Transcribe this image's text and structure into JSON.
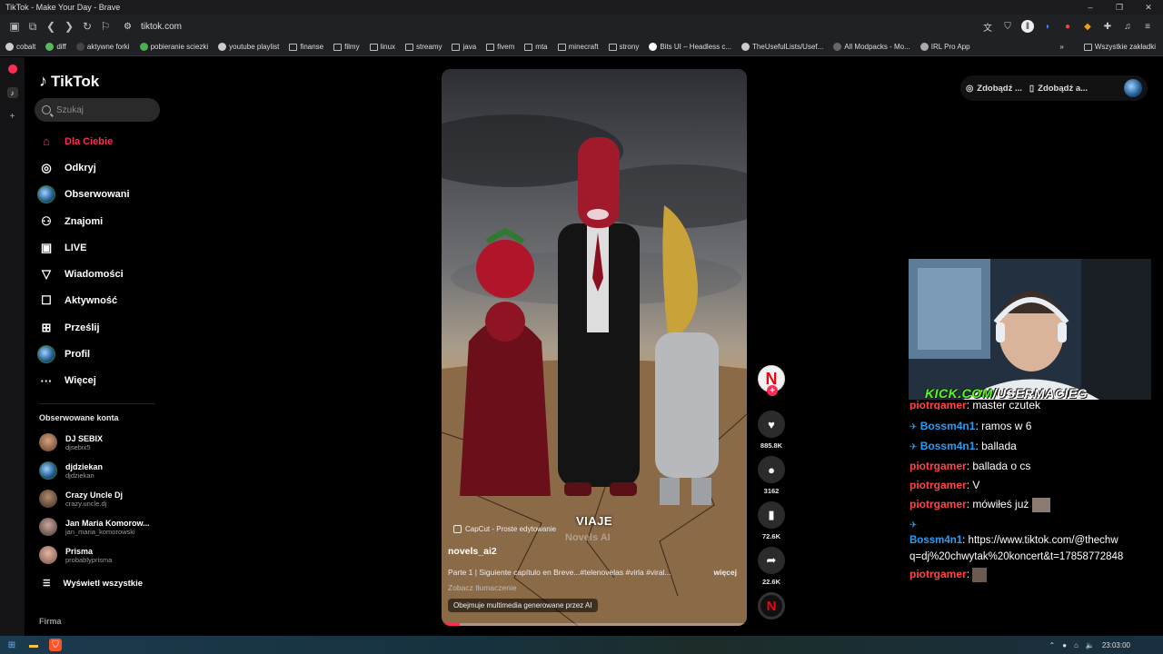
{
  "window": {
    "title": "TikTok - Make Your Day - Brave"
  },
  "address": {
    "url": "tiktok.com"
  },
  "bookmarks": {
    "items": [
      "cobalt",
      "diff",
      "aktywne forki",
      "pobieranie sciezki",
      "youtube playlist",
      "finanse",
      "filmy",
      "linux",
      "streamy",
      "java",
      "fivem",
      "mta",
      "minecraft",
      "strony",
      "Bits UI – Headless c...",
      "TheUsefulLists/Usef...",
      "All Modpacks - Mo...",
      "IRL Pro App"
    ],
    "more": "»",
    "all": "Wszystkie zakładki"
  },
  "sidebar": {
    "logo": "TikTok",
    "search_placeholder": "Szukaj",
    "menu": [
      {
        "label": "Dla Ciebie",
        "icon": "home-icon"
      },
      {
        "label": "Odkryj",
        "icon": "compass-icon"
      },
      {
        "label": "Obserwowani",
        "icon": "avatar"
      },
      {
        "label": "Znajomi",
        "icon": "friends-icon"
      },
      {
        "label": "LIVE",
        "icon": "live-icon"
      },
      {
        "label": "Wiadomości",
        "icon": "send-icon"
      },
      {
        "label": "Aktywność",
        "icon": "activity-icon"
      },
      {
        "label": "Prześlij",
        "icon": "upload-icon"
      },
      {
        "label": "Profil",
        "icon": "profile-icon"
      },
      {
        "label": "Więcej",
        "icon": "more-icon"
      }
    ],
    "following_header": "Obserwowane konta",
    "accounts": [
      {
        "name": "DJ SEBIX",
        "handle": "djsebix5"
      },
      {
        "name": "djdziekan",
        "handle": "djdziekan"
      },
      {
        "name": "Crazy Uncle Dj",
        "handle": "crazy.uncle.dj"
      },
      {
        "name": "Jan Maria Komorow...",
        "handle": "jan_maria_komorowski"
      },
      {
        "name": "Prisma",
        "handle": "probablyprisma"
      }
    ],
    "see_all": "Wyświetl wszystkie",
    "company": "Firma"
  },
  "video": {
    "template": "CapCut - Proste edytowanie",
    "overlay_title": "VIAJE",
    "overlay_watermark": "Novels AI",
    "author": "novels_ai2",
    "description": "Parte 1 | Siguiente capítulo en Breve...#telenovelas #virla #viral...",
    "more": "więcej",
    "translate": "Zobacz tłumaczenie",
    "ai_label": "Obejmuje multimedia generowane przez AI",
    "progress": 0.06
  },
  "actions": {
    "likes": "885.8K",
    "comments": "3162",
    "saves": "72.6K",
    "shares": "22.6K"
  },
  "topbar": {
    "get_coins": "Zdobądź ...",
    "get_app": "Zdobądź a..."
  },
  "stream": {
    "overlay_prefix": "KICK.COM",
    "overlay_slash": "/",
    "overlay_user": "USERMACIEG"
  },
  "chat": [
    {
      "user": "piotrgamer",
      "msg": ": master czutek",
      "type": "red"
    },
    {
      "user": "Bossm4n1",
      "msg": ": ramos w 6",
      "type": "blue"
    },
    {
      "user": "Bossm4n1",
      "msg": ": ballada",
      "type": "blue"
    },
    {
      "user": "piotrgamer",
      "msg": ": ballada o cs",
      "type": "red"
    },
    {
      "user": "piotrgamer",
      "msg": ": V",
      "type": "red"
    },
    {
      "user": "piotrgamer",
      "msg": ": mówiłeś już",
      "type": "red"
    }
  ],
  "chat_long": {
    "user": "Bossm4n1",
    "line1": ": https://www.tiktok.com/@thechw",
    "line2": "q=dj%20chwytak%20koncert&t=17858772848"
  },
  "chat_last": {
    "user": "piotrgamer",
    "msg": ":"
  },
  "taskbar": {
    "time": "23:03:00"
  }
}
